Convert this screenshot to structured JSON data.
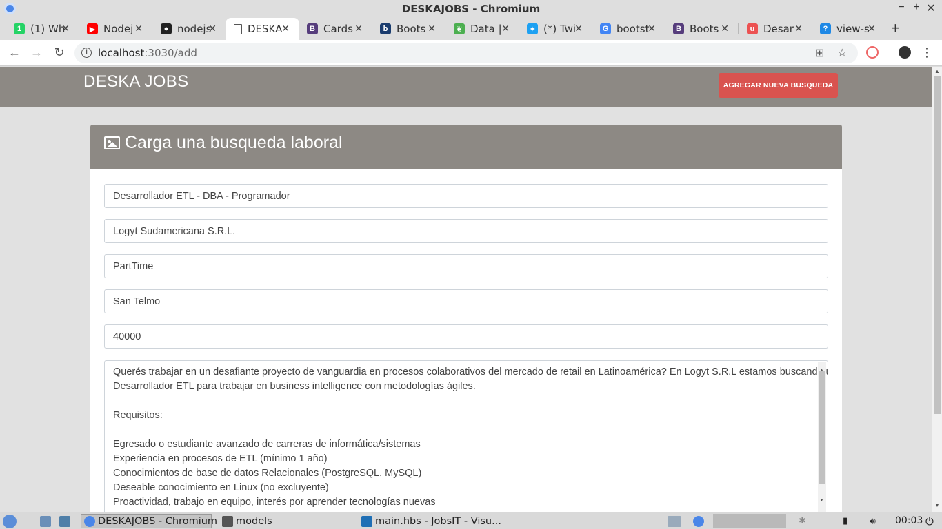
{
  "window": {
    "title": "DESKAJOBS - Chromium",
    "controls": [
      "−",
      "+",
      "✕"
    ]
  },
  "tabs": [
    {
      "label": "(1) Wh",
      "icon": "whatsapp-icon",
      "color": "#25d366",
      "glyph": "1"
    },
    {
      "label": "Nodej",
      "icon": "youtube-icon",
      "color": "#ff0000",
      "glyph": "▶"
    },
    {
      "label": "nodejs",
      "icon": "github-icon",
      "color": "#222222",
      "glyph": "●"
    },
    {
      "label": "DESKA",
      "icon": "page-icon",
      "color": "#ffffff",
      "glyph": "",
      "active": true
    },
    {
      "label": "Cards",
      "icon": "bootstrap-icon",
      "color": "#563d7c",
      "glyph": "B"
    },
    {
      "label": "Boots",
      "icon": "bootstrap-blog-icon",
      "color": "#1a3c6e",
      "glyph": "b"
    },
    {
      "label": "Data |",
      "icon": "mongodb-icon",
      "color": "#4caf50",
      "glyph": "❦"
    },
    {
      "label": "(*) Twi",
      "icon": "twitter-icon",
      "color": "#1da1f2",
      "glyph": "✦"
    },
    {
      "label": "bootst",
      "icon": "google-icon",
      "color": "#4285f4",
      "glyph": "G"
    },
    {
      "label": "Boots",
      "icon": "bootstrap-icon",
      "color": "#563d7c",
      "glyph": "B"
    },
    {
      "label": "Desar",
      "icon": "udemy-icon",
      "color": "#ec5252",
      "glyph": "u"
    },
    {
      "label": "view-s",
      "icon": "stackoverflow-icon",
      "color": "#1e88e5",
      "glyph": "?"
    }
  ],
  "address": {
    "host": "localhost",
    "path": ":3030/add"
  },
  "page": {
    "brand": "DESKA JOBS",
    "add_button": "AGREGAR NUEVA BUSQUEDA",
    "card_title": "Carga una busqueda laboral",
    "fields": {
      "title": "Desarrollador ETL - DBA - Programador",
      "company": "Logyt Sudamericana S.R.L.",
      "type": "PartTime",
      "location": "San Telmo",
      "salary": "40000"
    },
    "description_lines": [
      "Querés trabajar en un desafiante proyecto de vanguardia en procesos colaborativos del mercado de retail en Latinoamérica? En Logyt S.R.L estamos buscando un",
      "Desarrollador ETL para trabajar en business intelligence con metodologías ágiles.",
      "",
      "Requisitos:",
      "",
      "Egresado o estudiante avanzado de carreras de informática/sistemas",
      "Experiencia en procesos de ETL (mínimo 1 año)",
      "Conocimientos de base de datos Relacionales (PostgreSQL, MySQL)",
      "Deseable conocimiento en Linux (no excluyente)",
      "Proactividad, trabajo en equipo, interés por aprender tecnologías nuevas"
    ],
    "colors": {
      "navbar": "#8d8984",
      "button": "#d9534f",
      "background": "#e1e1e1"
    }
  },
  "taskbar": {
    "items": [
      {
        "label": "DESKAJOBS - Chromium",
        "icon": "chromium-icon"
      },
      {
        "label": "models",
        "icon": "folder-icon"
      },
      {
        "label": "main.hbs - JobsIT - Visu...",
        "icon": "vscode-icon"
      }
    ],
    "clock": "00:03"
  }
}
